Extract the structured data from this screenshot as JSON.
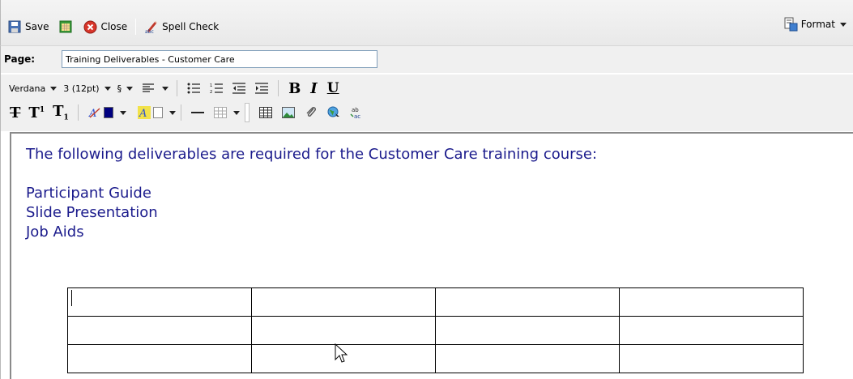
{
  "toolbar": {
    "save_label": "Save",
    "close_label": "Close",
    "spell_check_label": "Spell Check",
    "format_label": "Format"
  },
  "page": {
    "label": "Page:",
    "title_value": "Training Deliverables - Customer Care"
  },
  "formatting": {
    "font_family": "Verdana",
    "font_size": "3 (12pt)",
    "style_symbol": "§",
    "bold": "B",
    "italic": "I",
    "underline": "U",
    "strike": "T",
    "superscript_base": "T",
    "superscript_mark": "1",
    "subscript_base": "T",
    "subscript_mark": "1",
    "text_color": "#000080",
    "highlight_color": "#ffffff"
  },
  "editor": {
    "intro": "The following deliverables are required for the Customer Care training course:",
    "items": [
      "Participant Guide",
      "Slide Presentation",
      "Job Aids"
    ],
    "text_color": "#1b1b8c",
    "table": {
      "rows": 3,
      "cols": 4
    }
  },
  "icons": {
    "save": "floppy-disk-icon",
    "calendar": "calendar-grid-icon",
    "close": "close-icon",
    "spell_check": "spell-check-icon",
    "format": "format-icon"
  }
}
